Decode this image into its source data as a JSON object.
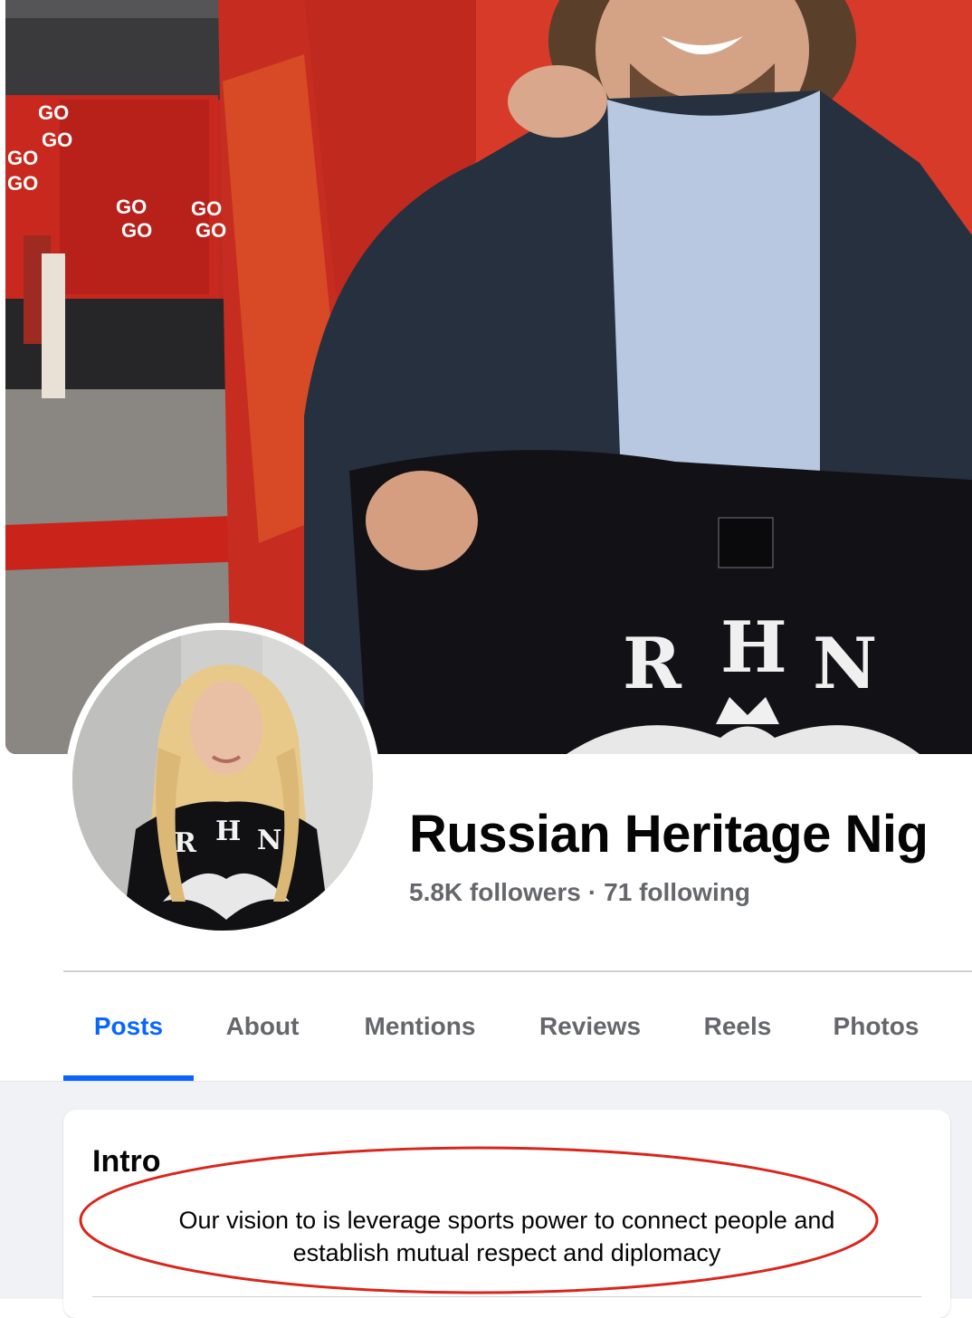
{
  "cover": {
    "shirt_letters": [
      "R",
      "H",
      "N"
    ],
    "banner_texts": [
      "GO",
      "GO",
      "GO",
      "GO",
      "GO",
      "GO",
      "GO",
      "GO"
    ]
  },
  "profile": {
    "name": "Russian Heritage Nig",
    "followers": "5.8K followers",
    "separator": "·",
    "following": "71 following"
  },
  "avatar": {
    "shirt_letters": [
      "R",
      "H",
      "N"
    ]
  },
  "tabs": [
    {
      "label": "Posts",
      "active": true
    },
    {
      "label": "About",
      "active": false
    },
    {
      "label": "Mentions",
      "active": false
    },
    {
      "label": "Reviews",
      "active": false
    },
    {
      "label": "Reels",
      "active": false
    },
    {
      "label": "Photos",
      "active": false
    }
  ],
  "intro": {
    "title": "Intro",
    "bio_line1": "Our vision to is leverage sports power to connect people and",
    "bio_line2": "establish mutual respect and diplomacy"
  },
  "colors": {
    "accent": "#0866ff",
    "secondary_text": "#65676b",
    "annotation": "#d9261c"
  }
}
